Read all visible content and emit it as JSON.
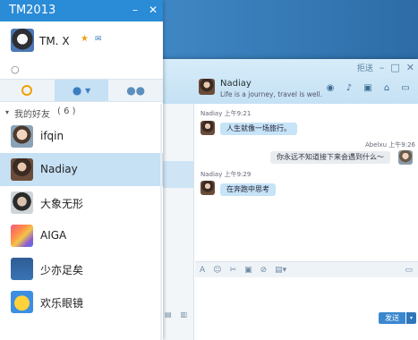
{
  "app": {
    "title": "TM2013"
  },
  "profile": {
    "name": "TM. X"
  },
  "search": {
    "placeholder": ""
  },
  "group": {
    "label": "我的好友",
    "count": "( 6 )"
  },
  "friends": [
    {
      "name": "ifqin"
    },
    {
      "name": "Nadiay"
    },
    {
      "name": "大象无形"
    },
    {
      "name": "AIGA"
    },
    {
      "name": "少亦足矣"
    },
    {
      "name": "欢乐眼镜"
    }
  ],
  "chat": {
    "title_hint": "拒送",
    "contact_name": "Nadiay",
    "signature": "Life is a journey, travel is well.",
    "messages": [
      {
        "sender": "Nadiay",
        "time": "上午9:21",
        "text": "人生就像一场旅行。"
      },
      {
        "sender": "Abelxu",
        "time": "上午9:26",
        "text": "你永远不知道接下来会遇到什么～"
      },
      {
        "sender": "Nadiay",
        "time": "上午9:29",
        "text": "在奔跑中思考"
      }
    ],
    "send_label": "发送"
  },
  "colors": {
    "accent": "#2a8bd6",
    "selected": "#c6e0f4",
    "bubble_in": "#c7e3f7",
    "bubble_out": "#e9edf0"
  }
}
